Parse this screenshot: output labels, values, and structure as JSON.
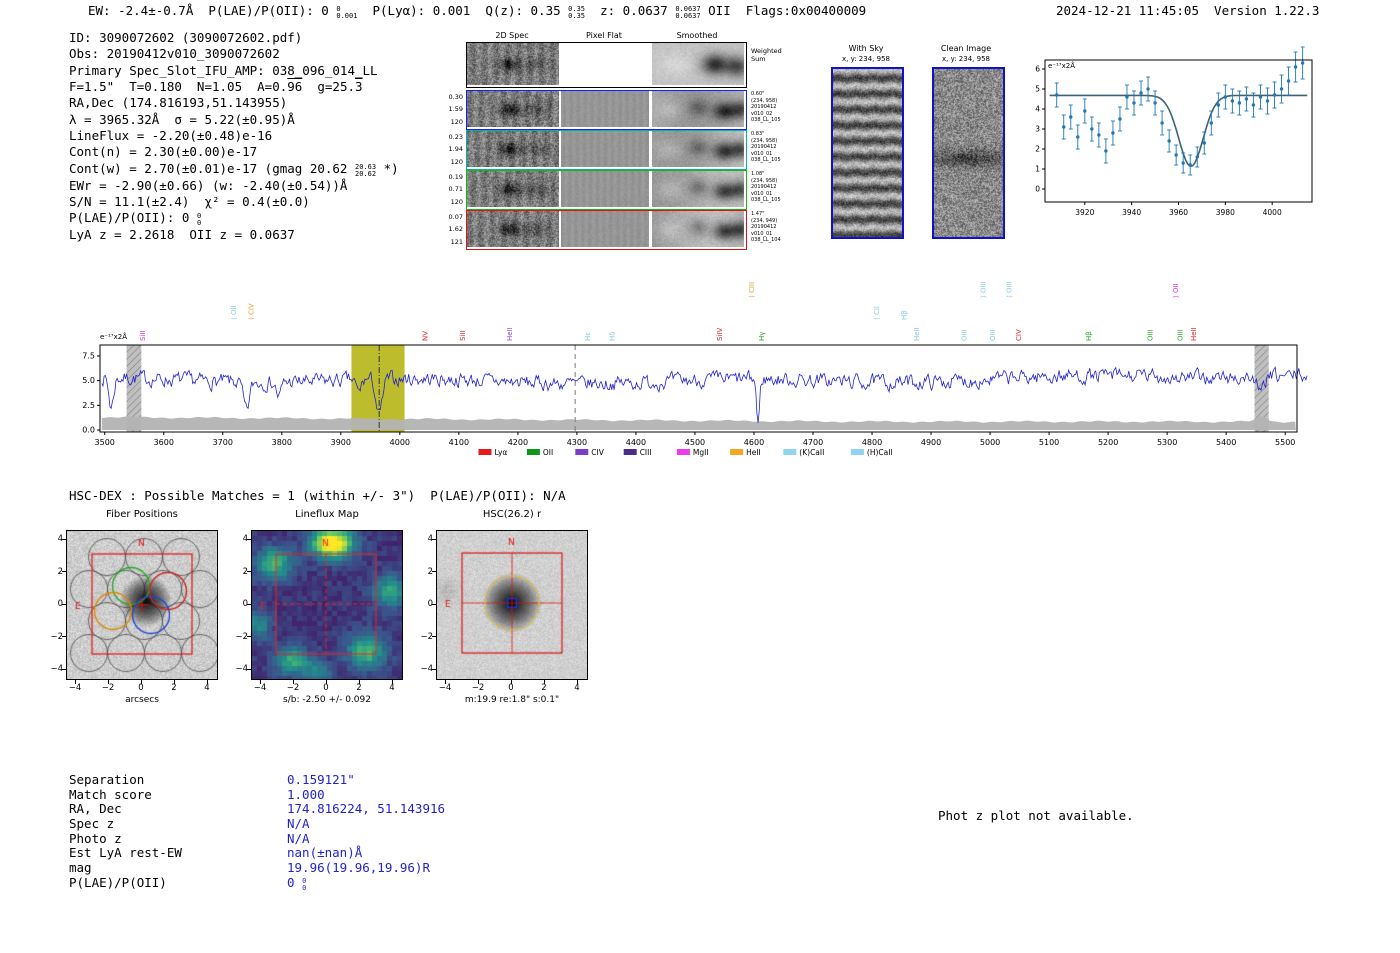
{
  "header": {
    "segments": [
      {
        "t": "EW: -2.4±-0.7Å  P(LAE)/P(OII): 0 "
      },
      {
        "stack": [
          "0",
          "0.001"
        ]
      },
      {
        "t": "  P(Lyα): 0.001  Q(z): 0.35 "
      },
      {
        "stack": [
          "0.35",
          "0.35"
        ]
      },
      {
        "t": "  z: 0.0637 "
      },
      {
        "stack": [
          "0.0637",
          "0.0637"
        ]
      },
      {
        "t": " OII  Flags:0x00400009"
      }
    ],
    "timestamp": "2024-12-21 11:45:05  Version 1.22.3"
  },
  "info_lines": [
    [
      {
        "t": "ID: 3090072602 (3090072602.pdf)"
      }
    ],
    [
      {
        "t": "Obs: 20190412v010_3090072602"
      }
    ],
    [
      {
        "t": "Primary Spec_Slot_IFU_AMP: 038_096_014_LL"
      }
    ],
    [
      {
        "t": "F=1.5\"  T=0.180  N=1.05  A=0."
      },
      {
        "ol": "96"
      },
      {
        "t": "  g=25."
      },
      {
        "ol": "3"
      }
    ],
    [
      {
        "t": "RA,Dec (174.816193,51.143955)"
      }
    ],
    [
      {
        "t": "λ = 3965.32Å  σ = 5.22(±0.95)Å"
      }
    ],
    [
      {
        "t": "LineFlux = -2.20(±0.48)e-16"
      }
    ],
    [
      {
        "t": "Cont(n) = 2.30(±0.00)e-17"
      }
    ],
    [
      {
        "t": "Cont(w) = 2.70(±0.01)e-17 (gmag 20.62 "
      },
      {
        "stack": [
          "20.63",
          "20.62"
        ]
      },
      {
        "t": " *)"
      }
    ],
    [
      {
        "t": "EWr = -2.90(±0.66) (w: -2.40(±0.54))Å"
      }
    ],
    [
      {
        "t": "S/N = 11.1(±2.4)  χ² = 0.4(±0.0)"
      }
    ],
    [
      {
        "t": "P(LAE)/P(OII): 0 "
      },
      {
        "stack": [
          "0",
          "0"
        ]
      }
    ],
    [
      {
        "t": "LyA z = 2.2618  OII z = 0.0637"
      }
    ]
  ],
  "spec2d": {
    "titles": [
      "2D Spec",
      "Pixel Flat",
      "Smoothed"
    ],
    "weighted_label": [
      "Weighted",
      "Sum"
    ],
    "rows": [
      {
        "border": "#1122ee",
        "left": [
          "0.30",
          "1.59",
          "120"
        ],
        "right": [
          "0.60\"",
          "(234, 958)",
          "20190412",
          "v010_02",
          "038_LL_105"
        ]
      },
      {
        "border": "#00b3a4",
        "left": [
          "0.23",
          "1.94",
          "120"
        ],
        "right": [
          "0.83\"",
          "(234, 958)",
          "20190412",
          "v010_01",
          "038_LL_105"
        ]
      },
      {
        "border": "#15b315",
        "left": [
          "0.19",
          "0.71",
          "120"
        ],
        "right": [
          "1.08\"",
          "(234, 958)",
          "20190412",
          "v010_01",
          "038_LL_105"
        ]
      },
      {
        "border": "#e01010",
        "left": [
          "0.07",
          "1.62",
          "121"
        ],
        "right": [
          "1.47\"",
          "(234, 949)",
          "20190412",
          "v010_01",
          "038_LL_104"
        ]
      }
    ]
  },
  "sky": {
    "with_sky": {
      "title": "With Sky",
      "xy": "x, y: 234, 958"
    },
    "clean": {
      "title": "Clean Image",
      "xy": "x, y: 234, 958"
    }
  },
  "hsc": {
    "header": "HSC-DEX : Possible Matches = 1 (within +/- 3\")  P(LAE)/P(OII): N/A"
  },
  "cutouts": {
    "panels": [
      {
        "title": "Fiber Positions",
        "xlabel": "arcsecs"
      },
      {
        "title": "Lineflux Map",
        "xlabel": "s/b: -2.50 +/- 0.092"
      },
      {
        "title": "HSC(26.2) r",
        "xlabel": "m:19.9 re:1.8\" s:0.1\""
      }
    ],
    "tick_values": [
      -4,
      -2,
      0,
      2,
      4
    ],
    "compass": {
      "north": "N",
      "east": "E"
    }
  },
  "match_table": {
    "rows": [
      {
        "label": "Separation",
        "value": [
          {
            "t": "0.159121\""
          }
        ]
      },
      {
        "label": "Match score",
        "value": [
          {
            "t": "1.000"
          }
        ]
      },
      {
        "label": "RA, Dec",
        "value": [
          {
            "t": "174.816224, 51.143916"
          }
        ]
      },
      {
        "label": "Spec z",
        "value": [
          {
            "t": "N/A"
          }
        ]
      },
      {
        "label": "Photo z",
        "value": [
          {
            "t": "N/A"
          }
        ]
      },
      {
        "label": "Est LyA rest-EW",
        "value": [
          {
            "t": "nan(±nan)Å"
          }
        ]
      },
      {
        "label": "mag",
        "value": [
          {
            "t": "19.96(19.96,19.96)R"
          }
        ]
      },
      {
        "label": "P(LAE)/P(OII)",
        "value": [
          {
            "t": "0 "
          },
          {
            "stack": [
              "0",
              "0"
            ]
          }
        ]
      }
    ]
  },
  "footnote": "Phot z plot not available.",
  "chart_data": [
    {
      "type": "scatter",
      "title": "emission-line gaussian fit",
      "ylabel": "e⁻¹⁷x2Å",
      "xlim": [
        3903,
        4017
      ],
      "ylim": [
        -0.65,
        6.45
      ],
      "xticks": [
        3920,
        3940,
        3960,
        3980,
        4000
      ],
      "yticks": [
        0,
        1,
        2,
        3,
        4,
        5,
        6
      ],
      "fit": {
        "continuum": 4.68,
        "amplitude": -3.55,
        "center": 3965.32,
        "sigma": 5.22
      },
      "points": {
        "x": [
          3908,
          3911,
          3914,
          3917,
          3920,
          3923,
          3926,
          3929,
          3932,
          3935,
          3938,
          3941,
          3944,
          3947,
          3950,
          3953,
          3956,
          3959,
          3962,
          3965,
          3968,
          3971,
          3974,
          3977,
          3980,
          3983,
          3986,
          3989,
          3992,
          3995,
          3998,
          4001,
          4004,
          4007,
          4010,
          4013
        ],
        "y": [
          4.7,
          3.1,
          3.6,
          2.6,
          3.9,
          3.0,
          2.7,
          1.9,
          2.8,
          3.5,
          4.6,
          4.3,
          4.8,
          5.0,
          4.3,
          3.3,
          2.4,
          1.7,
          1.3,
          1.2,
          1.6,
          2.3,
          3.3,
          4.2,
          4.6,
          4.4,
          4.3,
          4.5,
          4.2,
          4.6,
          4.4,
          4.7,
          5.0,
          5.4,
          6.1,
          6.3
        ],
        "err": [
          0.6,
          0.6,
          0.6,
          0.6,
          0.6,
          0.6,
          0.6,
          0.6,
          0.6,
          0.6,
          0.6,
          0.6,
          0.6,
          0.6,
          0.6,
          0.6,
          0.55,
          0.5,
          0.5,
          0.5,
          0.5,
          0.55,
          0.6,
          0.6,
          0.6,
          0.6,
          0.6,
          0.6,
          0.6,
          0.6,
          0.65,
          0.65,
          0.7,
          0.7,
          0.75,
          0.8
        ]
      }
    },
    {
      "type": "line",
      "title": "full 1D spectrum",
      "ylabel": "e⁻¹⁷x2Å",
      "xlim": [
        3492,
        5520
      ],
      "ylim": [
        -0.2,
        8.61
      ],
      "xticks": [
        3500,
        3600,
        3700,
        3800,
        3900,
        4000,
        4100,
        4200,
        4300,
        4400,
        4500,
        4600,
        4700,
        4800,
        4900,
        5000,
        5100,
        5200,
        5300,
        5400,
        5500
      ],
      "yticks": [
        0,
        2.5,
        5,
        7.5
      ],
      "ytick_labels": [
        "0.0",
        "2.5",
        "5.0",
        "7.5"
      ],
      "highlight": {
        "x0": 3918,
        "x1": 4008,
        "color": "#b8b821"
      },
      "gray_bands": [
        [
          3537,
          3562
        ],
        [
          5448,
          5472
        ]
      ],
      "dashed_lines": [
        {
          "x": 3965,
          "style": "dashdot"
        },
        {
          "x": 4297,
          "style": "dashed"
        }
      ],
      "synthetic": {
        "seed": 7,
        "base": 4.9,
        "slope": 0.0003,
        "noise": 1.25,
        "features": [
          {
            "x": 3511,
            "a": -3.0,
            "s": 4
          },
          {
            "x": 3740,
            "a": -3.0,
            "s": 5
          },
          {
            "x": 3795,
            "a": -1.5,
            "s": 4
          },
          {
            "x": 3930,
            "a": -1.3,
            "s": 4
          },
          {
            "x": 3965,
            "a": -3.7,
            "s": 5.2
          },
          {
            "x": 4607,
            "a": -4.6,
            "s": 2.5
          },
          {
            "x": 5458,
            "a": -1.8,
            "s": 5
          }
        ]
      },
      "error_band": {
        "left": 1.3,
        "min": 0.85,
        "slope": 0.00035,
        "bump_x": 5460,
        "bump_a": 0.55
      },
      "line_labels": [
        {
          "wl": 3568,
          "text": "SiII",
          "color": "#cc33cc",
          "lv": 1
        },
        {
          "wl": 3722,
          "text": "OII",
          "color": "#85c9e8",
          "lv": 2,
          "br": "⟨"
        },
        {
          "wl": 3752,
          "text": "CIV",
          "color": "#e0a030",
          "lv": 2,
          "br": "⟨"
        },
        {
          "wl": 4047,
          "text": "NV",
          "color": "#d62728",
          "lv": 1
        },
        {
          "wl": 4110,
          "text": "SiII",
          "color": "#d62728",
          "lv": 1
        },
        {
          "wl": 4190,
          "text": "HeII",
          "color": "#8950c8",
          "lv": 1
        },
        {
          "wl": 4322,
          "text": "Hε",
          "color": "#85c9e8",
          "lv": 1
        },
        {
          "wl": 4364,
          "text": "Hδ",
          "color": "#85c9e8",
          "lv": 1
        },
        {
          "wl": 4546,
          "text": "SiIV",
          "color": "#d62728",
          "lv": 1
        },
        {
          "wl": 4600,
          "text": "CIII",
          "color": "#e0a030",
          "lv": 3,
          "br": "⟨"
        },
        {
          "wl": 4617,
          "text": "Hγ",
          "color": "#2ca02c",
          "lv": 1
        },
        {
          "wl": 4812,
          "text": "CII",
          "color": "#85c9e8",
          "lv": 2,
          "br": "⟨"
        },
        {
          "wl": 4858,
          "text": "Hβ",
          "color": "#85c9e8",
          "lv": 2
        },
        {
          "wl": 4880,
          "text": "HeII",
          "color": "#85c9e8",
          "lv": 1
        },
        {
          "wl": 4960,
          "text": "OIII",
          "color": "#85c9e8",
          "lv": 1
        },
        {
          "wl": 4992,
          "text": "OIII",
          "color": "#85c9e8",
          "lv": 3,
          "br": "⟩"
        },
        {
          "wl": 5008,
          "text": "OIII",
          "color": "#85c9e8",
          "lv": 1
        },
        {
          "wl": 5036,
          "text": "OIII",
          "color": "#85c9e8",
          "lv": 3,
          "br": "⟨"
        },
        {
          "wl": 5052,
          "text": "CIV",
          "color": "#d62728",
          "lv": 1
        },
        {
          "wl": 5171,
          "text": "Hβ",
          "color": "#2ca02c",
          "lv": 1
        },
        {
          "wl": 5275,
          "text": "OIII",
          "color": "#2ca02c",
          "lv": 1
        },
        {
          "wl": 5318,
          "text": "OII",
          "color": "#dd33dd",
          "lv": 3,
          "br": "⟩"
        },
        {
          "wl": 5326,
          "text": "OIII",
          "color": "#2ca02c",
          "lv": 1
        },
        {
          "wl": 5349,
          "text": "HeII",
          "color": "#d62728",
          "lv": 1
        }
      ],
      "legend": [
        {
          "label": "Lyα",
          "color": "#e41a1c"
        },
        {
          "label": "OII",
          "color": "#109618"
        },
        {
          "label": "CIV",
          "color": "#7d3cc8"
        },
        {
          "label": "CIII",
          "color": "#4b2d83"
        },
        {
          "label": "MgII",
          "color": "#ea3ce8"
        },
        {
          "label": "HeII",
          "color": "#f5a623"
        },
        {
          "label": "(K)CaII",
          "color": "#8fd4f0"
        },
        {
          "label": "(H)CaII",
          "color": "#8fd4f0"
        }
      ]
    }
  ]
}
